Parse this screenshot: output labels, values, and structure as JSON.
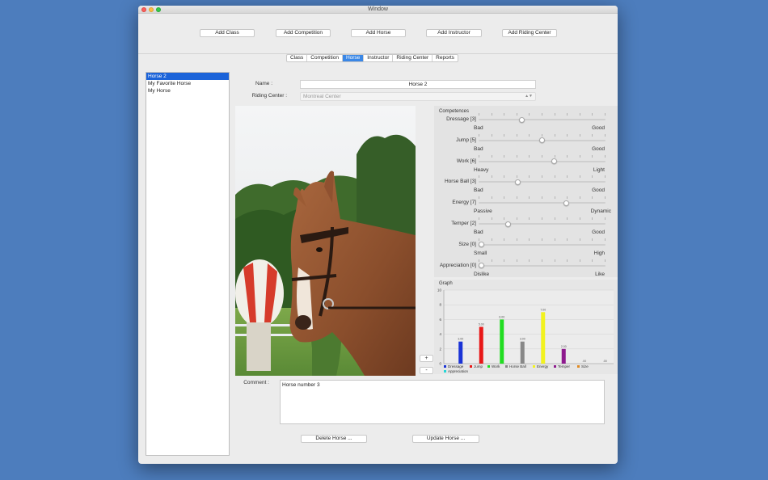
{
  "window": {
    "title": "Window"
  },
  "toolbar": {
    "add_class": "Add Class",
    "add_competition": "Add Competition",
    "add_horse": "Add Horse",
    "add_instructor": "Add Instructor",
    "add_riding_center": "Add Riding Center"
  },
  "tabs": [
    {
      "label": "Class"
    },
    {
      "label": "Competition"
    },
    {
      "label": "Horse",
      "active": true
    },
    {
      "label": "Instructor"
    },
    {
      "label": "Riding Center"
    },
    {
      "label": "Reports"
    }
  ],
  "horse_list": [
    "Horse 2",
    "My Favorite Horse",
    "My Horse"
  ],
  "form": {
    "name_label": "Name :",
    "name_value": "Horse 2",
    "riding_center_label": "Riding Center :",
    "riding_center_value": "Montreal Center",
    "comment_label": "Comment :",
    "comment_value": "Horse number 3"
  },
  "competences": {
    "title": "Competences",
    "sliders": [
      {
        "label": "Dressage [3]",
        "min": "Bad",
        "max": "Good",
        "level": 0.33
      },
      {
        "label": "Jump [5]",
        "min": "Bad",
        "max": "Good",
        "level": 0.5
      },
      {
        "label": "Work [6]",
        "min": "Heavy",
        "max": "Light",
        "level": 0.6
      },
      {
        "label": "Horse Ball [3]",
        "min": "Bad",
        "max": "Good",
        "level": 0.3
      },
      {
        "label": "Energy [7]",
        "min": "Passive",
        "max": "Dynamic",
        "level": 0.7
      },
      {
        "label": "Temper [2]",
        "min": "Bad",
        "max": "Good",
        "level": 0.22
      },
      {
        "label": "Size [0]",
        "min": "Small",
        "max": "High",
        "level": 0
      },
      {
        "label": "Appreciation [0]",
        "min": "Dislike",
        "max": "Like",
        "level": 0
      }
    ]
  },
  "graph": {
    "title": "Graph"
  },
  "chart_data": {
    "type": "bar",
    "categories": [
      "Dressage",
      "Jump",
      "Work",
      "Horse Ball",
      "Energy",
      "Temper",
      "Size",
      "Appreciation"
    ],
    "values": [
      3,
      5,
      6,
      3,
      7,
      2,
      0,
      0
    ],
    "value_labels": [
      "3.00",
      "5.00",
      "6.00",
      "3.00",
      "7.00",
      "2.00",
      ".00",
      ".00"
    ],
    "colors": [
      "#1a33d6",
      "#e81818",
      "#22dd22",
      "#888888",
      "#f2f21f",
      "#8e1a8e",
      "#e08a22",
      "#27d6d6"
    ],
    "ylim": [
      0,
      10
    ],
    "yticks": [
      "0",
      "2",
      "4",
      "6",
      "8",
      "10"
    ],
    "grid": true,
    "legend": "bottom"
  },
  "stepper": {
    "plus": "+",
    "minus": "-"
  },
  "actions": {
    "delete": "Delete Horse ...",
    "update": "Update Horse ..."
  }
}
